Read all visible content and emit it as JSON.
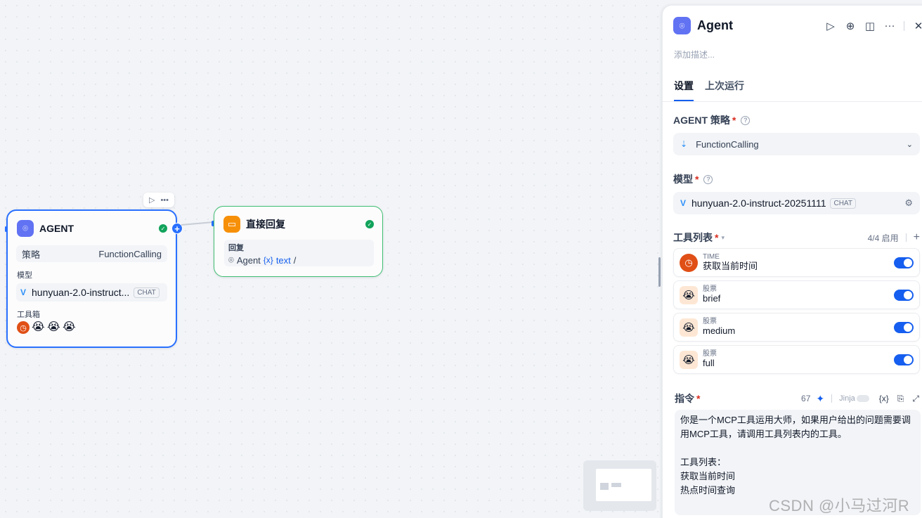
{
  "canvas": {
    "agent_node": {
      "title": "AGENT",
      "strategy_label": "策略",
      "strategy_value": "FunctionCalling",
      "model_label": "模型",
      "model_value": "hunyuan-2.0-instruct...",
      "model_tag": "CHAT",
      "toolbox_label": "工具箱",
      "tool_icons": [
        "clock-icon",
        "crying-face-icon",
        "crying-face-icon",
        "crying-face-icon"
      ]
    },
    "reply_node": {
      "title": "直接回复",
      "reply_label": "回复",
      "var_node": "Agent",
      "var_symbol": "{x}",
      "var_name": "text",
      "var_suffix": "/"
    }
  },
  "panel": {
    "title": "Agent",
    "description_placeholder": "添加描述...",
    "tabs": [
      {
        "label": "设置",
        "active": true
      },
      {
        "label": "上次运行",
        "active": false
      }
    ],
    "strategy": {
      "label": "AGENT 策略",
      "required": "*",
      "value": "FunctionCalling"
    },
    "model": {
      "label": "模型",
      "required": "*",
      "value": "hunyuan-2.0-instruct-20251111",
      "tag": "CHAT"
    },
    "tools": {
      "label": "工具列表",
      "required": "*",
      "count": "4/4 启用",
      "add": "+",
      "items": [
        {
          "provider": "TIME",
          "name": "获取当前时间",
          "icon": "clock-icon",
          "enabled": true
        },
        {
          "provider": "股票",
          "name": "brief",
          "icon": "crying-face-icon",
          "enabled": true
        },
        {
          "provider": "股票",
          "name": "medium",
          "icon": "crying-face-icon",
          "enabled": true
        },
        {
          "provider": "股票",
          "name": "full",
          "icon": "crying-face-icon",
          "enabled": true
        }
      ]
    },
    "instruction": {
      "label": "指令",
      "required": "*",
      "char_count": "67",
      "jinja_label": "Jinja",
      "var_button": "{x}",
      "text": "你是一个MCP工具运用大师，如果用户给出的问题需要调用MCP工具，请调用工具列表内的工具。\n\n工具列表：\n获取当前时间\n热点时间查询"
    }
  },
  "watermark": "CSDN @小马过河R",
  "colors": {
    "primary": "#155eef",
    "agent_icon": "#6172f3",
    "reply_icon": "#f79009",
    "success": "#12a35b"
  }
}
